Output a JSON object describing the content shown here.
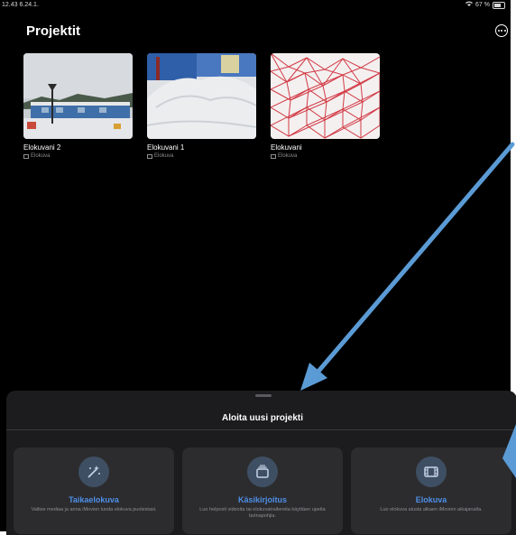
{
  "status": {
    "time": "12.43",
    "date": "6.24.1.",
    "wifi_battery": "67 %"
  },
  "header": {
    "title": "Projektit",
    "more_icon": "ellipsis-circle-icon"
  },
  "projects": [
    {
      "title": "Elokuvani 2",
      "type": "Elokuva"
    },
    {
      "title": "Elokuvani 1",
      "type": "Elokuva"
    },
    {
      "title": "Elokuvani",
      "type": "Elokuva"
    }
  ],
  "new_project_sheet": {
    "title": "Aloita uusi projekti",
    "options": [
      {
        "icon": "magic-wand-icon",
        "label": "Taikaelokuva",
        "description": "Valitse mediaa ja anna iMovien luoda elokuva puolestasi."
      },
      {
        "icon": "storyboard-icon",
        "label": "Käsikirjoitus",
        "description": "Luo helposti videoita tai elokuvatrailereita käyttäen upeita tarinapohjia."
      },
      {
        "icon": "film-strip-icon",
        "label": "Elokuva",
        "description": "Luo elokuva alusta alkaen iMovien aikajanalla."
      }
    ]
  },
  "colors": {
    "background": "#000000",
    "sheet": "#1c1c1e",
    "card": "#2c2c2e",
    "accent": "#4e8fe8",
    "annotation_arrow": "#5b9bd5"
  }
}
